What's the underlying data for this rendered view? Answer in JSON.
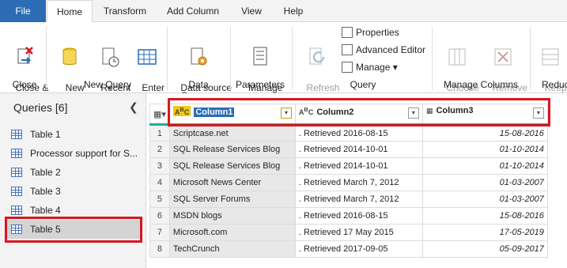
{
  "menu": {
    "tabs": [
      "File",
      "Home",
      "Transform",
      "Add Column",
      "View",
      "Help"
    ]
  },
  "ribbon": {
    "close_apply": "Close &\nApply",
    "close_group": "Close",
    "new_source": "New\nSource",
    "recent_sources": "Recent\nSources",
    "enter_data": "Enter\nData",
    "new_query_group": "New Query",
    "data_source_settings": "Data source\nsettings",
    "data_sources_group": "Data Sources",
    "manage_parameters": "Manage\nParameters",
    "parameters_group": "Parameters",
    "refresh_preview": "Refresh\nPreview",
    "properties": "Properties",
    "advanced_editor": "Advanced Editor",
    "manage": "Manage",
    "query_group": "Query",
    "choose_columns": "Choose\nColumns",
    "remove_columns": "Remove\nColumns",
    "manage_columns_group": "Manage Columns",
    "keep_rows": "Keep\nRows",
    "reduce_group": "Reduc"
  },
  "queries": {
    "header": "Queries [6]",
    "items": [
      "Table 1",
      "Processor support for S...",
      "Table 2",
      "Table 3",
      "Table 4",
      "Table 5"
    ],
    "selected": "Table 5"
  },
  "table": {
    "columns": [
      "Column1",
      "Column2",
      "Column3"
    ],
    "rows": [
      {
        "n": "1",
        "c1": "Scriptcase.net",
        "c2": ". Retrieved 2016-08-15",
        "c3": "15-08-2016"
      },
      {
        "n": "2",
        "c1": "SQL Release Services Blog",
        "c2": ". Retrieved 2014-10-01",
        "c3": "01-10-2014"
      },
      {
        "n": "3",
        "c1": "SQL Release Services Blog",
        "c2": ". Retrieved 2014-10-01",
        "c3": "01-10-2014"
      },
      {
        "n": "4",
        "c1": "Microsoft News Center",
        "c2": ". Retrieved March 7, 2012",
        "c3": "01-03-2007"
      },
      {
        "n": "5",
        "c1": "SQL Server Forums",
        "c2": ". Retrieved March 7, 2012",
        "c3": "01-03-2007"
      },
      {
        "n": "6",
        "c1": "MSDN blogs",
        "c2": ". Retrieved 2016-08-15",
        "c3": "15-08-2016"
      },
      {
        "n": "7",
        "c1": "Microsoft.com",
        "c2": ". Retrieved 17 May 2015",
        "c3": "17-05-2019"
      },
      {
        "n": "8",
        "c1": "TechCrunch",
        "c2": ". Retrieved 2017-09-05",
        "c3": "05-09-2017"
      }
    ]
  },
  "colors": {
    "accent": "#2b6cb5",
    "highlight": "#d7171f",
    "column_bar": "#1aaf9c"
  }
}
